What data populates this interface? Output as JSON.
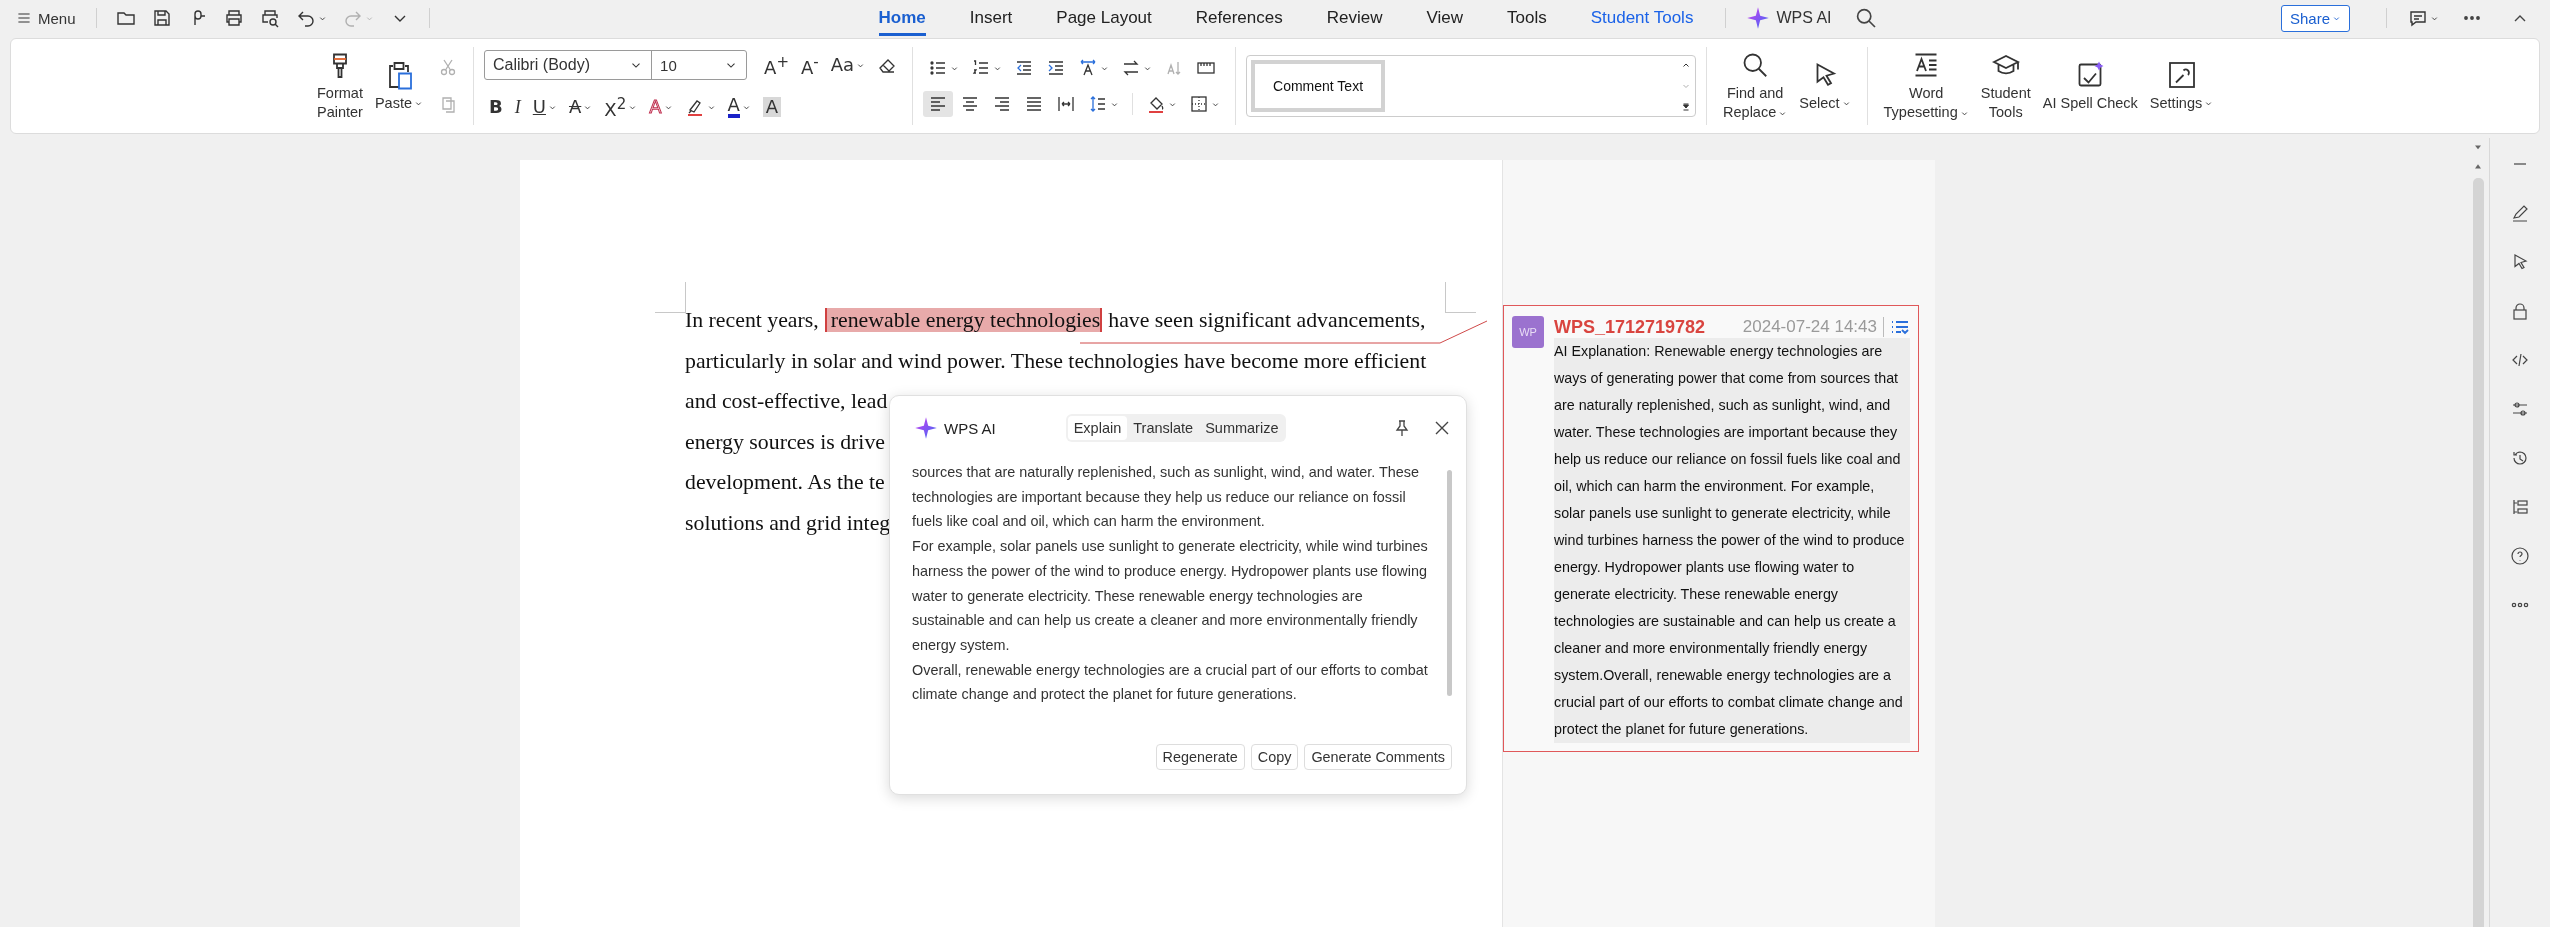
{
  "top_bar": {
    "menu_label": "Menu",
    "quick_tools": [
      {
        "disabled": false,
        "dropdown": false
      },
      {
        "disabled": false,
        "dropdown": false
      },
      {
        "disabled": false,
        "dropdown": false
      },
      {
        "disabled": false,
        "dropdown": false
      },
      {
        "disabled": false,
        "dropdown": false
      },
      {
        "disabled": false,
        "dropdown": true
      },
      {
        "disabled": true,
        "dropdown": true
      },
      {
        "disabled": false,
        "dropdown": false
      }
    ],
    "tabs": [
      {
        "label": "Home",
        "selected": true,
        "kind": "standard"
      },
      {
        "label": "Insert",
        "selected": false,
        "kind": "standard"
      },
      {
        "label": "Page Layout",
        "selected": false,
        "kind": "standard"
      },
      {
        "label": "References",
        "selected": false,
        "kind": "standard"
      },
      {
        "label": "Review",
        "selected": false,
        "kind": "standard"
      },
      {
        "label": "View",
        "selected": false,
        "kind": "standard"
      },
      {
        "label": "Tools",
        "selected": false,
        "kind": "standard"
      },
      {
        "label": "Student Tools",
        "selected": false,
        "kind": "contextual"
      }
    ],
    "ai_label": "WPS AI",
    "share_label": "Share"
  },
  "ribbon": {
    "format_painter": {
      "lines": [
        "Format",
        "Painter"
      ]
    },
    "paste": {
      "lines": [
        "Paste"
      ],
      "dropdown": true
    },
    "clip_small": [
      {
        "disabled": true
      },
      {
        "disabled": true
      }
    ],
    "font_family": "Calibri (Body)",
    "font_size": "10",
    "font_row_1": [
      {
        "kind": "glyph",
        "glyph": "A$^{+}$",
        "dropdown": false
      },
      {
        "kind": "glyph",
        "glyph": "A$^{-}$",
        "dropdown": false
      },
      {
        "kind": "glyph",
        "glyph": "Aa",
        "dropdown": true
      },
      {
        "kind": "icon",
        "dropdown": false
      }
    ],
    "font_row_2": [
      {
        "kind": "glyph",
        "glyph": "B",
        "dropdown": false
      },
      {
        "kind": "glyph",
        "glyph": "I",
        "dropdown": false
      },
      {
        "kind": "glyph",
        "glyph": "U",
        "dropdown": true
      },
      {
        "kind": "glyph",
        "glyph": "A",
        "dropdown": true
      },
      {
        "kind": "glyph",
        "glyph": "X$^{2}$",
        "dropdown": true
      },
      {
        "kind": "glyph",
        "glyph": "A",
        "dropdown": true
      },
      {
        "kind": "icon",
        "dropdown": true
      },
      {
        "kind": "glyph",
        "glyph": "A",
        "dropdown": true
      },
      {
        "kind": "glyph",
        "glyph": "A",
        "dropdown": false
      }
    ],
    "paragraph_row_1": [
      {
        "disabled": false,
        "dropdown": true
      },
      {
        "disabled": false,
        "dropdown": true
      },
      {
        "disabled": false,
        "dropdown": false
      },
      {
        "disabled": false,
        "dropdown": false
      },
      {
        "disabled": false,
        "dropdown": true
      },
      {
        "disabled": false,
        "dropdown": true
      },
      {
        "disabled": true,
        "dropdown": false
      },
      {
        "disabled": false,
        "dropdown": false
      }
    ],
    "paragraph_row_2": [
      {
        "selected": true,
        "dropdown": false
      },
      {
        "selected": false,
        "dropdown": false
      },
      {
        "selected": false,
        "dropdown": false
      },
      {
        "selected": false,
        "dropdown": false
      },
      {
        "selected": false,
        "dropdown": false
      },
      {
        "selected": false,
        "dropdown": true
      },
      {
        "selected": false,
        "dropdown": true
      },
      {
        "selected": false,
        "dropdown": true
      }
    ],
    "style_gallery": {
      "style": "Comment Text"
    },
    "large_tools": [
      {
        "lines": [
          "Find and",
          "Replace"
        ],
        "dropdown": true
      },
      {
        "lines": [
          "Select"
        ],
        "dropdown": true
      },
      {
        "lines": [
          "Word",
          "Typesetting"
        ],
        "dropdown": true
      },
      {
        "lines": [
          "Student",
          "Tools"
        ],
        "dropdown": false
      },
      {
        "lines": [
          "AI Spell Check"
        ],
        "dropdown": false
      },
      {
        "lines": [
          "Settings"
        ],
        "dropdown": true
      }
    ]
  },
  "document": {
    "lines": [
      {
        "segments": [
          {
            "text": "In recent years,",
            "highlighted": false
          },
          {
            "text": "renewable energy technologies",
            "highlighted": true
          },
          {
            "text": "have seen significant advancements,",
            "highlighted": false
          }
        ]
      },
      {
        "segments": [
          {
            "text": "particularly in solar and wind power. These technologies have become more efficient",
            "highlighted": false
          }
        ]
      },
      {
        "segments": [
          {
            "text": "and cost-effective, lead",
            "highlighted": false
          }
        ]
      },
      {
        "segments": [
          {
            "text": "energy sources is drive",
            "highlighted": false
          }
        ]
      },
      {
        "segments": [
          {
            "text": "development. As the te",
            "highlighted": false
          }
        ]
      },
      {
        "segments": [
          {
            "text": "solutions and grid integ",
            "highlighted": false
          }
        ]
      }
    ]
  },
  "ai_panel": {
    "title": "WPS AI",
    "modes": [
      {
        "label": "Explain",
        "selected": true
      },
      {
        "label": "Translate",
        "selected": false
      },
      {
        "label": "Summarize",
        "selected": false
      }
    ],
    "paragraphs": [
      "sources that are naturally replenished, such as sunlight, wind, and water. These technologies are important because they help us reduce our reliance on fossil fuels like coal and oil, which can harm the environment.",
      "For example, solar panels use sunlight to generate electricity, while wind turbines harness the power of the wind to produce energy. Hydropower plants use flowing water to generate electricity. These renewable energy technologies are sustainable and can help us create a cleaner and more environmentally friendly energy system.",
      "Overall, renewable energy technologies are a crucial part of our efforts to combat climate change and protect the planet for future generations."
    ],
    "actions": [
      "Regenerate",
      "Copy",
      "Generate Comments"
    ]
  },
  "comment": {
    "avatar": "WP",
    "author": "WPS_1712719782",
    "time": "2024-07-24 14:43",
    "body": "AI Explanation: Renewable energy technologies are ways of generating power that come from sources that are naturally replenished, such as sunlight, wind, and water. These technologies are important because they help us reduce our reliance on fossil fuels like coal and oil, which can harm the environment. For example, solar panels use sunlight to generate electricity, while wind turbines harness the power of the wind to produce energy. Hydropower plants use flowing water to generate electricity. These renewable energy technologies are sustainable and can help us create a cleaner and more environmentally friendly energy system.Overall, renewable energy technologies are a crucial part of our efforts to combat climate change and protect the planet for future generations."
  }
}
